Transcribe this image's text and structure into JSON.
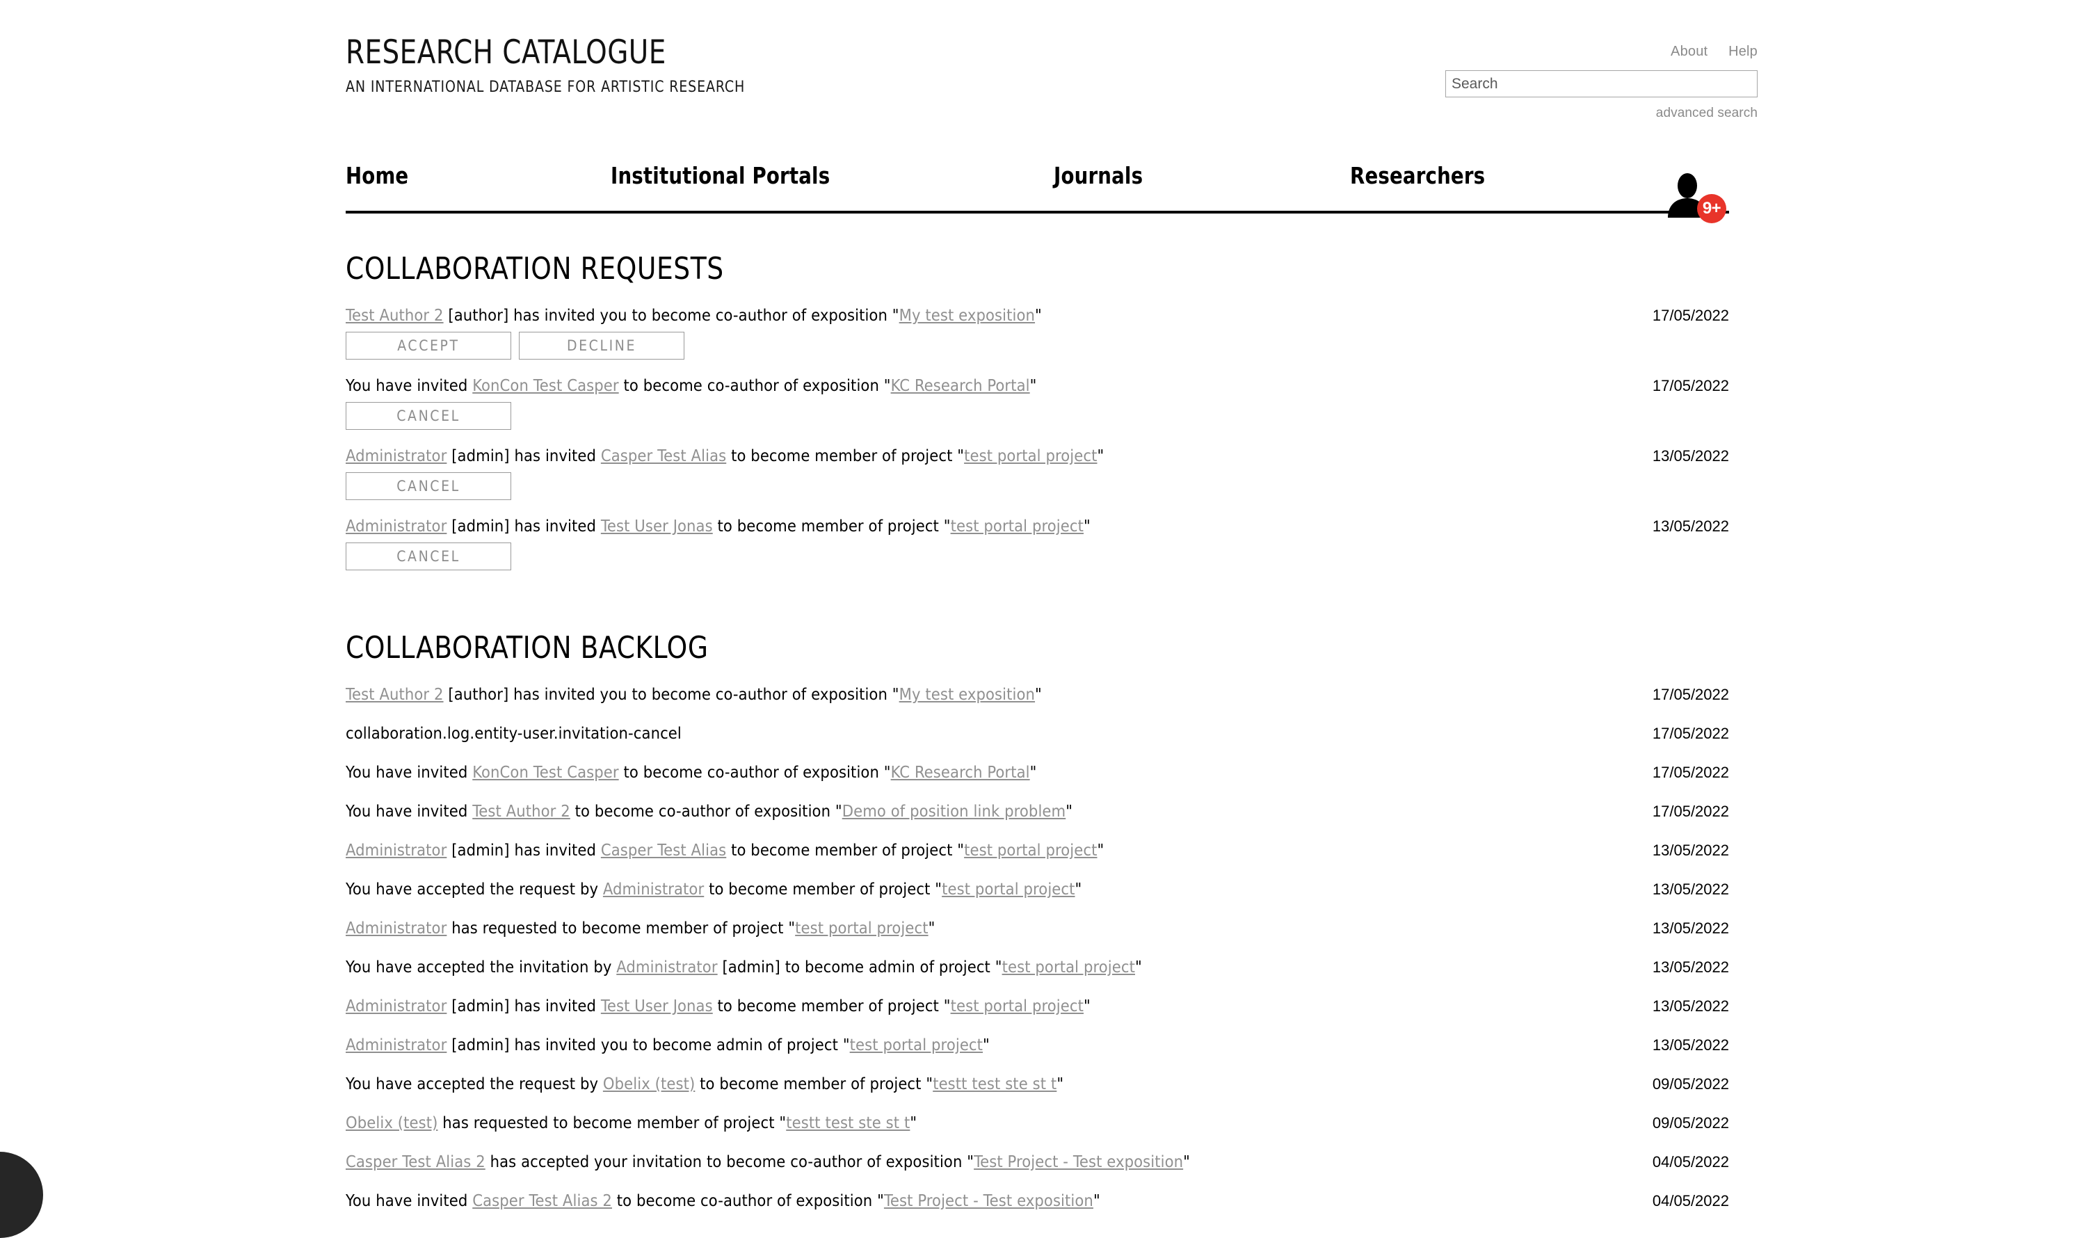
{
  "brand": {
    "title": "RESEARCH CATALOGUE",
    "subtitle": "AN INTERNATIONAL DATABASE FOR ARTISTIC RESEARCH"
  },
  "header": {
    "about_label": "About",
    "help_label": "Help",
    "search_placeholder": "Search",
    "search_value": "",
    "advanced_search_label": "advanced search"
  },
  "nav": {
    "items": [
      {
        "label": "Home"
      },
      {
        "label": "Institutional Portals"
      },
      {
        "label": "Journals"
      },
      {
        "label": "Researchers"
      }
    ],
    "notification_badge": "9+",
    "avatar_icon": "user-silhouette-icon",
    "badge_color": "#e8342a"
  },
  "requests": {
    "title": "COLLABORATION REQUESTS",
    "rows": [
      {
        "parts": [
          {
            "type": "link",
            "text": "Test Author 2"
          },
          {
            "type": "text",
            "text": " [author] has invited you to become co-author of exposition \""
          },
          {
            "type": "link",
            "text": "My test exposition"
          },
          {
            "type": "text",
            "text": "\""
          }
        ],
        "date": "17/05/2022",
        "buttons": [
          "ACCEPT",
          "DECLINE"
        ]
      },
      {
        "parts": [
          {
            "type": "text",
            "text": "You have invited "
          },
          {
            "type": "link",
            "text": "KonCon Test Casper"
          },
          {
            "type": "text",
            "text": " to become co-author of exposition \""
          },
          {
            "type": "link",
            "text": "KC Research Portal"
          },
          {
            "type": "text",
            "text": "\""
          }
        ],
        "date": "17/05/2022",
        "buttons": [
          "CANCEL"
        ]
      },
      {
        "parts": [
          {
            "type": "link",
            "text": "Administrator"
          },
          {
            "type": "text",
            "text": " [admin] has invited "
          },
          {
            "type": "link",
            "text": "Casper Test Alias"
          },
          {
            "type": "text",
            "text": " to become member of project \""
          },
          {
            "type": "link",
            "text": "test portal project"
          },
          {
            "type": "text",
            "text": "\""
          }
        ],
        "date": "13/05/2022",
        "buttons": [
          "CANCEL"
        ]
      },
      {
        "parts": [
          {
            "type": "link",
            "text": "Administrator"
          },
          {
            "type": "text",
            "text": " [admin] has invited "
          },
          {
            "type": "link",
            "text": "Test User Jonas"
          },
          {
            "type": "text",
            "text": " to become member of project \""
          },
          {
            "type": "link",
            "text": "test portal project"
          },
          {
            "type": "text",
            "text": "\""
          }
        ],
        "date": "13/05/2022",
        "buttons": [
          "CANCEL"
        ]
      }
    ]
  },
  "backlog": {
    "title": "COLLABORATION BACKLOG",
    "rows": [
      {
        "parts": [
          {
            "type": "link",
            "text": "Test Author 2"
          },
          {
            "type": "text",
            "text": " [author] has invited you to become co-author of exposition \""
          },
          {
            "type": "link",
            "text": "My test exposition"
          },
          {
            "type": "text",
            "text": "\""
          }
        ],
        "date": "17/05/2022"
      },
      {
        "parts": [
          {
            "type": "text",
            "text": "collaboration.log.entity-user.invitation-cancel"
          }
        ],
        "date": "17/05/2022"
      },
      {
        "parts": [
          {
            "type": "text",
            "text": "You have invited "
          },
          {
            "type": "link",
            "text": "KonCon Test Casper"
          },
          {
            "type": "text",
            "text": " to become co-author of exposition \""
          },
          {
            "type": "link",
            "text": "KC Research Portal"
          },
          {
            "type": "text",
            "text": "\""
          }
        ],
        "date": "17/05/2022"
      },
      {
        "parts": [
          {
            "type": "text",
            "text": "You have invited "
          },
          {
            "type": "link",
            "text": "Test Author 2"
          },
          {
            "type": "text",
            "text": " to become co-author of exposition \""
          },
          {
            "type": "link",
            "text": "Demo of position link problem"
          },
          {
            "type": "text",
            "text": "\""
          }
        ],
        "date": "17/05/2022"
      },
      {
        "parts": [
          {
            "type": "link",
            "text": "Administrator"
          },
          {
            "type": "text",
            "text": " [admin] has invited "
          },
          {
            "type": "link",
            "text": "Casper Test Alias"
          },
          {
            "type": "text",
            "text": " to become member of project \""
          },
          {
            "type": "link",
            "text": "test portal project"
          },
          {
            "type": "text",
            "text": "\""
          }
        ],
        "date": "13/05/2022"
      },
      {
        "parts": [
          {
            "type": "text",
            "text": "You have accepted the request by "
          },
          {
            "type": "link",
            "text": "Administrator"
          },
          {
            "type": "text",
            "text": " to become member of project \""
          },
          {
            "type": "link",
            "text": "test portal project"
          },
          {
            "type": "text",
            "text": "\""
          }
        ],
        "date": "13/05/2022"
      },
      {
        "parts": [
          {
            "type": "link",
            "text": "Administrator"
          },
          {
            "type": "text",
            "text": " has requested to become member of project \""
          },
          {
            "type": "link",
            "text": "test portal project"
          },
          {
            "type": "text",
            "text": "\""
          }
        ],
        "date": "13/05/2022"
      },
      {
        "parts": [
          {
            "type": "text",
            "text": "You have accepted the invitation by "
          },
          {
            "type": "link",
            "text": "Administrator"
          },
          {
            "type": "text",
            "text": " [admin] to become admin of project \""
          },
          {
            "type": "link",
            "text": "test portal project"
          },
          {
            "type": "text",
            "text": "\""
          }
        ],
        "date": "13/05/2022"
      },
      {
        "parts": [
          {
            "type": "link",
            "text": "Administrator"
          },
          {
            "type": "text",
            "text": " [admin] has invited "
          },
          {
            "type": "link",
            "text": "Test User Jonas"
          },
          {
            "type": "text",
            "text": " to become member of project \""
          },
          {
            "type": "link",
            "text": "test portal project"
          },
          {
            "type": "text",
            "text": "\""
          }
        ],
        "date": "13/05/2022"
      },
      {
        "parts": [
          {
            "type": "link",
            "text": "Administrator"
          },
          {
            "type": "text",
            "text": " [admin] has invited you to become admin of project \""
          },
          {
            "type": "link",
            "text": "test portal project"
          },
          {
            "type": "text",
            "text": "\""
          }
        ],
        "date": "13/05/2022"
      },
      {
        "parts": [
          {
            "type": "text",
            "text": "You have accepted the request by "
          },
          {
            "type": "link",
            "text": "Obelix (test)"
          },
          {
            "type": "text",
            "text": " to become member of project \""
          },
          {
            "type": "link",
            "text": "testt test ste st t"
          },
          {
            "type": "text",
            "text": "\""
          }
        ],
        "date": "09/05/2022"
      },
      {
        "parts": [
          {
            "type": "link",
            "text": "Obelix (test)"
          },
          {
            "type": "text",
            "text": " has requested to become member of project \""
          },
          {
            "type": "link",
            "text": "testt test ste st t"
          },
          {
            "type": "text",
            "text": "\""
          }
        ],
        "date": "09/05/2022"
      },
      {
        "parts": [
          {
            "type": "link",
            "text": "Casper Test Alias 2"
          },
          {
            "type": "text",
            "text": " has accepted your invitation to become co-author of exposition \""
          },
          {
            "type": "link",
            "text": "Test Project - Test exposition"
          },
          {
            "type": "text",
            "text": "\""
          }
        ],
        "date": "04/05/2022"
      },
      {
        "parts": [
          {
            "type": "text",
            "text": "You have invited "
          },
          {
            "type": "link",
            "text": "Casper Test Alias 2"
          },
          {
            "type": "text",
            "text": " to become co-author of exposition \""
          },
          {
            "type": "link",
            "text": "Test Project - Test exposition"
          },
          {
            "type": "text",
            "text": "\""
          }
        ],
        "date": "04/05/2022"
      }
    ]
  }
}
